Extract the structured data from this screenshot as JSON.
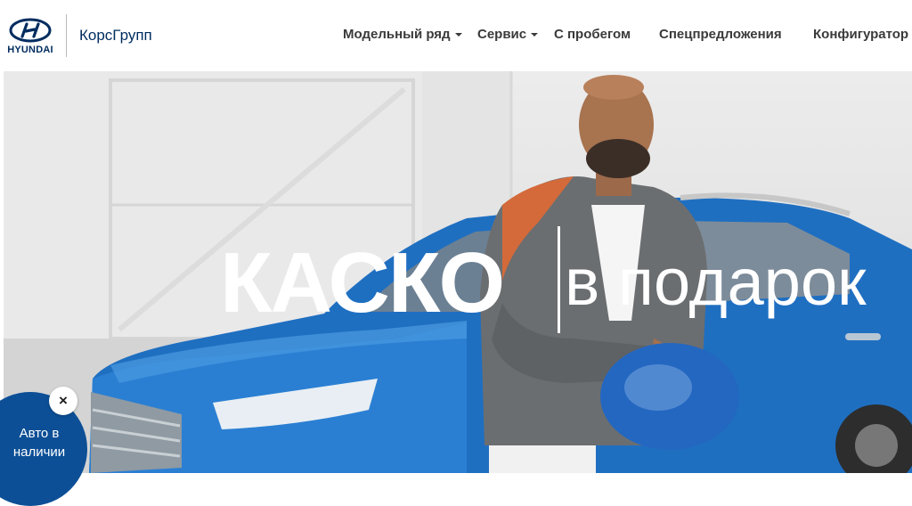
{
  "header": {
    "brand": "HYUNDAI",
    "dealer": "КорсГрупп",
    "nav": [
      {
        "label": "Модельный ряд",
        "has_dropdown": true
      },
      {
        "label": "Сервис",
        "has_dropdown": true
      },
      {
        "label": "С пробегом",
        "has_dropdown": false
      },
      {
        "label": "Спецпредложения",
        "has_dropdown": false
      },
      {
        "label": "Конфигуратор",
        "has_dropdown": false
      }
    ]
  },
  "hero": {
    "title": "КАСКО",
    "subtitle": "в подарок"
  },
  "stock_widget": {
    "label": "Авто в наличии",
    "close": "×"
  },
  "colors": {
    "brand_navy": "#002c5f",
    "badge_blue": "#0c4f96",
    "car_blue": "#1f6fc1"
  }
}
